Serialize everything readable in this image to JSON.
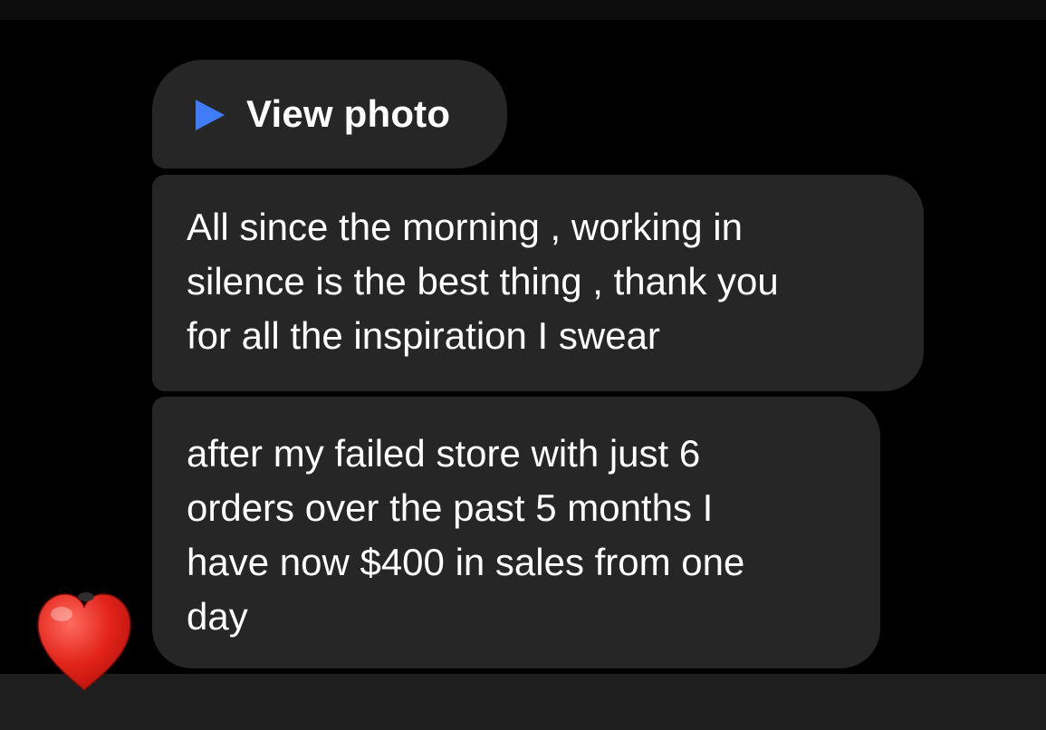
{
  "thread": {
    "photo_message": {
      "icon": "play-icon",
      "label": "View photo"
    },
    "messages": [
      {
        "text": "All since the morning , working in\nsilence is the best thing , thank you\nfor all the inspiration I swear"
      },
      {
        "text": "after my failed store with just 6\norders over the past 5 months I\nhave now $400 in sales from one\nday"
      }
    ],
    "reaction": {
      "icon": "red-heart-icon",
      "color": "#e2231a"
    }
  },
  "colors": {
    "background": "#000000",
    "bubble": "#262626",
    "text": "#ffffff",
    "accent": "#3f7cf6"
  }
}
